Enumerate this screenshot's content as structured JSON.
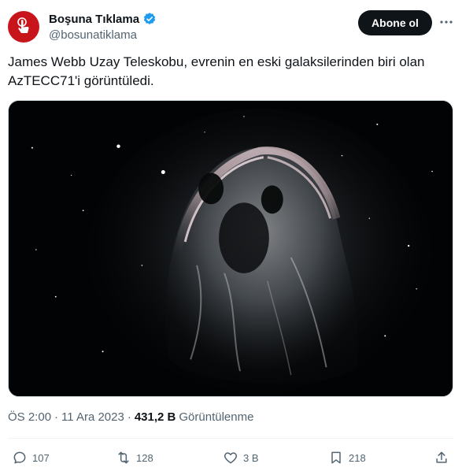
{
  "account": {
    "display_name": "Boşuna Tıklama",
    "handle": "@bosunatiklama",
    "verified": true,
    "avatar_color": "#c8141b"
  },
  "follow_button": {
    "label": "Abone ol"
  },
  "more_icon": "more-horizontal-icon",
  "tweet": {
    "text": "James Webb Uzay Teleskobu, evrenin en eski galaksilerinden biri olan AzTECC71'i görüntüledi."
  },
  "meta": {
    "time": "ÖS 2:00",
    "separator": "·",
    "date": "11 Ara 2023",
    "views_count": "431,2 B",
    "views_label": "Görüntülenme"
  },
  "actions": {
    "replies": "107",
    "reposts": "128",
    "likes": "3 B",
    "bookmarks": "218"
  },
  "colors": {
    "text_primary": "#0f1419",
    "text_secondary": "#536471",
    "verified_blue": "#1d9bf0",
    "divider": "#eff3f4"
  }
}
